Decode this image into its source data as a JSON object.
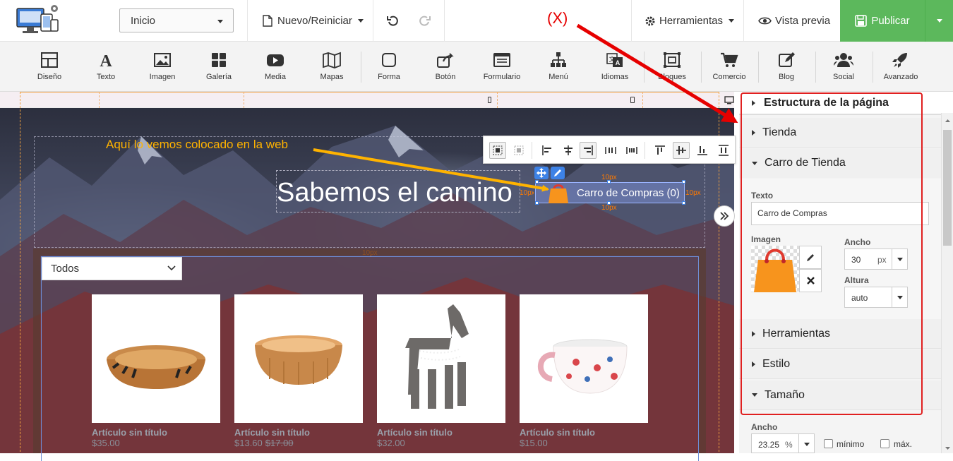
{
  "topbar": {
    "page_selector": "Inicio",
    "new_reset": "Nuevo/Reiniciar",
    "tools": "Herramientas",
    "preview": "Vista previa",
    "publish": "Publicar",
    "annotation_mark": "(X)"
  },
  "ribbon": {
    "items": [
      {
        "label": "Diseño",
        "icon": "layout-icon"
      },
      {
        "label": "Texto",
        "icon": "text-icon"
      },
      {
        "label": "Imagen",
        "icon": "image-icon"
      },
      {
        "label": "Galería",
        "icon": "gallery-icon"
      },
      {
        "label": "Media",
        "icon": "media-icon"
      },
      {
        "label": "Mapas",
        "icon": "map-icon"
      },
      {
        "label": "Forma",
        "icon": "shape-icon"
      },
      {
        "label": "Botón",
        "icon": "button-icon"
      },
      {
        "label": "Formulario",
        "icon": "form-icon"
      },
      {
        "label": "Menú",
        "icon": "menu-icon"
      },
      {
        "label": "Idiomas",
        "icon": "language-icon"
      },
      {
        "label": "Bloques",
        "icon": "blocks-icon"
      },
      {
        "label": "Comercio",
        "icon": "cart-icon"
      },
      {
        "label": "Blog",
        "icon": "blog-icon"
      },
      {
        "label": "Social",
        "icon": "social-icon"
      },
      {
        "label": "Avanzado",
        "icon": "rocket-icon"
      }
    ]
  },
  "canvas": {
    "slogan": "Sabemos el camino",
    "annotation": "Aquí lo vemos colocado en la web",
    "cart_widget_label": "Carro de Compras (0)",
    "padding_label": "10px",
    "category_filter": "Todos",
    "products": [
      {
        "title": "Artículo sin título",
        "price": "$35.00",
        "old_price": ""
      },
      {
        "title": "Artículo sin título",
        "price": "$13.60",
        "old_price": "$17.00"
      },
      {
        "title": "Artículo sin título",
        "price": "$32.00",
        "old_price": ""
      },
      {
        "title": "Artículo sin título",
        "price": "$15.00",
        "old_price": ""
      }
    ]
  },
  "panel": {
    "page_structure": "Estructura de la página",
    "sections": {
      "store": "Tienda",
      "cart": "Carro de Tienda",
      "tools": "Herramientas",
      "style": "Estilo",
      "size": "Tamaño"
    },
    "cart_fields": {
      "text_label": "Texto",
      "text_value": "Carro de Compras",
      "image_label": "Imagen",
      "width_label": "Ancho",
      "width_value": "30",
      "width_unit": "px",
      "height_label": "Altura",
      "height_value": "auto"
    },
    "size_fields": {
      "width_label": "Ancho",
      "width_value": "23.25",
      "width_unit": "%",
      "min_label": "mínimo",
      "max_label": "máx."
    }
  },
  "colors": {
    "publish": "#5cb85c",
    "annotation_yellow": "#ffb300",
    "annotation_red": "#e60000",
    "cart_orange": "#f7941d",
    "selection_blue": "#3d82e6"
  }
}
